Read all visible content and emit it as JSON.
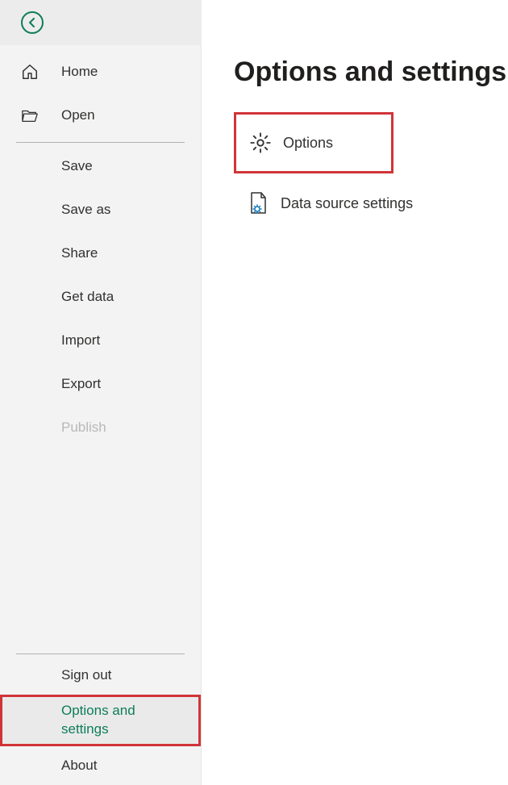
{
  "sidebar": {
    "items": [
      {
        "label": "Home"
      },
      {
        "label": "Open"
      },
      {
        "label": "Save"
      },
      {
        "label": "Save as"
      },
      {
        "label": "Share"
      },
      {
        "label": "Get data"
      },
      {
        "label": "Import"
      },
      {
        "label": "Export"
      },
      {
        "label": "Publish"
      }
    ],
    "bottom": [
      {
        "label": "Sign out"
      },
      {
        "label": "Options and settings"
      },
      {
        "label": "About"
      }
    ]
  },
  "main": {
    "title": "Options and settings",
    "rows": [
      {
        "label": "Options"
      },
      {
        "label": "Data source settings"
      }
    ]
  }
}
